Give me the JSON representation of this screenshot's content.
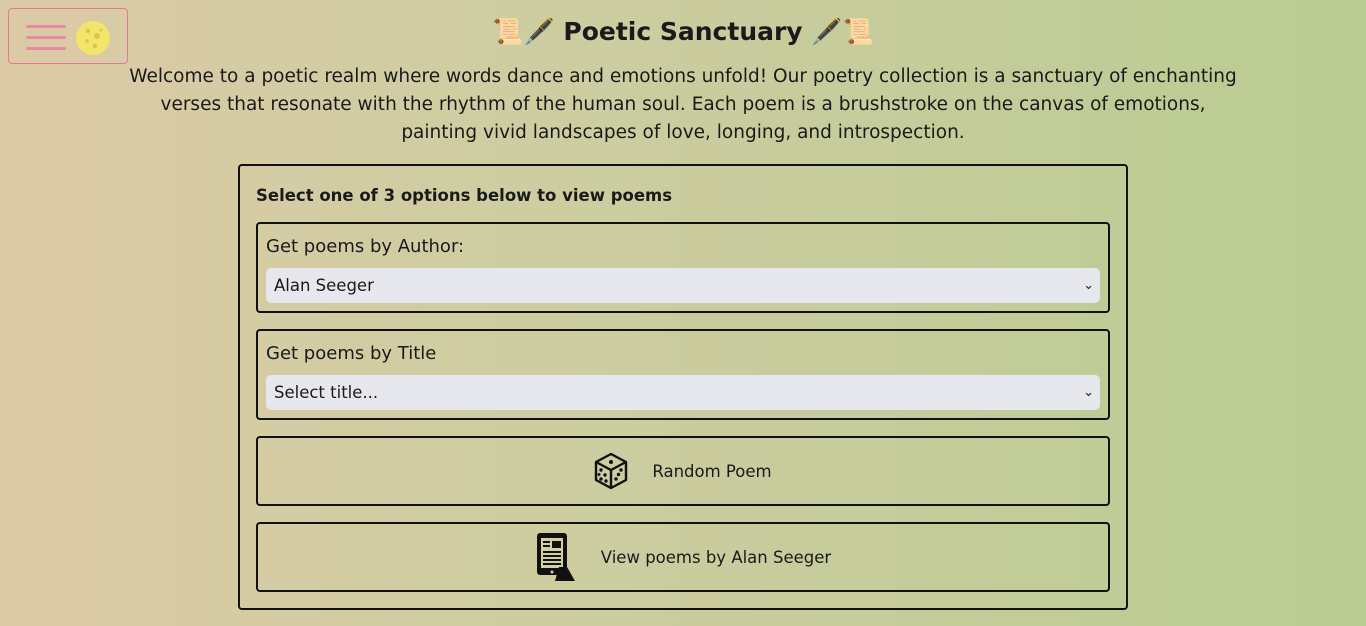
{
  "header": {
    "title": "Poetic Sanctuary",
    "title_emoji_left": "📜🖋️",
    "title_emoji_right": "🖋️📜",
    "intro": "Welcome to a poetic realm where words dance and emotions unfold! Our poetry collection is a sanctuary of enchanting verses that resonate with the rhythm of the human soul. Each poem is a brushstroke on the canvas of emotions, painting vivid landscapes of love, longing, and introspection."
  },
  "nav": {
    "menu_icon": "hamburger-icon",
    "theme_icon": "moon-icon"
  },
  "panel": {
    "heading": "Select one of 3 options below to view poems",
    "author": {
      "label": "Get poems by Author:",
      "selected": "Alan Seeger"
    },
    "title": {
      "label": "Get poems by Title",
      "selected": "Select title..."
    },
    "random_button": {
      "label": "Random Poem",
      "icon": "dice-icon"
    },
    "view_button": {
      "label": "View poems by Alan Seeger",
      "icon": "ereader-icon"
    }
  },
  "colors": {
    "accent": "#e98aa3",
    "moon": "#f3e56a"
  }
}
